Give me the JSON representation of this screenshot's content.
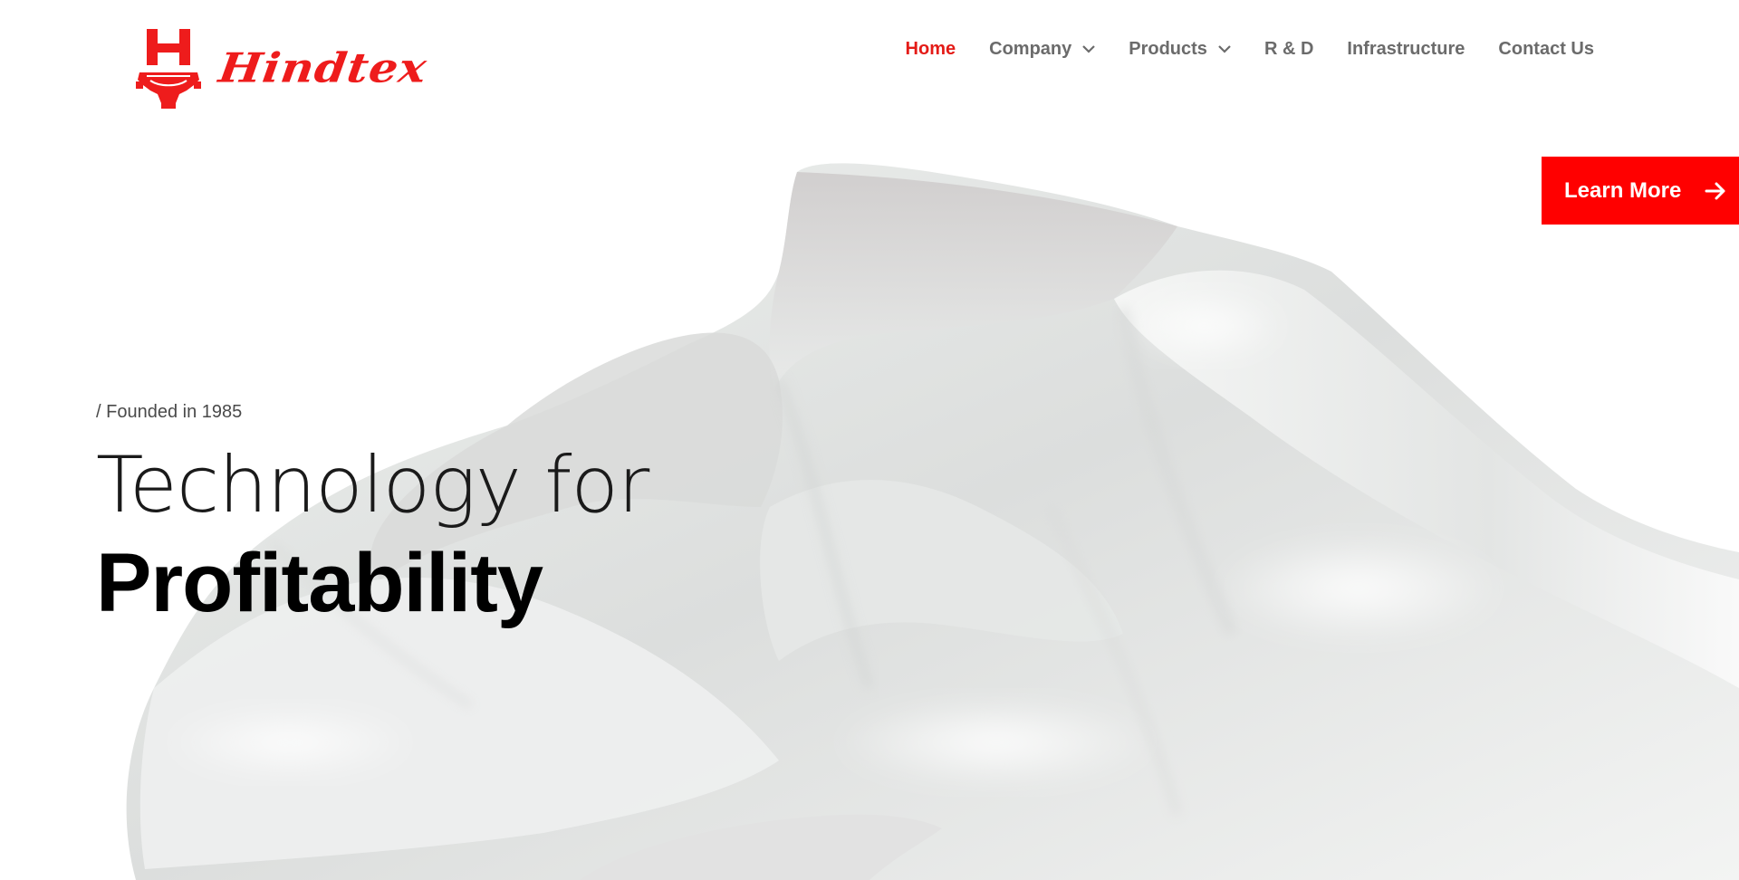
{
  "brand": {
    "name": "Hindtex",
    "logo_icon": "h-gear-logo-icon",
    "color": "#ee1c1c"
  },
  "nav": {
    "items": [
      {
        "label": "Home",
        "active": true,
        "has_dropdown": false
      },
      {
        "label": "Company",
        "active": false,
        "has_dropdown": true
      },
      {
        "label": "Products",
        "active": false,
        "has_dropdown": true
      },
      {
        "label": "R & D",
        "active": false,
        "has_dropdown": false
      },
      {
        "label": "Infrastructure",
        "active": false,
        "has_dropdown": false
      },
      {
        "label": "Contact Us",
        "active": false,
        "has_dropdown": false
      }
    ],
    "active_color": "#e41b17",
    "color": "#6b6b6b"
  },
  "cta": {
    "label": "Learn More",
    "icon": "arrow-right-icon",
    "color": "#ff0000"
  },
  "hero": {
    "eyebrow": "/ Founded in 1985",
    "headline_light": "Technology for",
    "headline_bold": "Profitability",
    "background": "white-fabric-image"
  }
}
